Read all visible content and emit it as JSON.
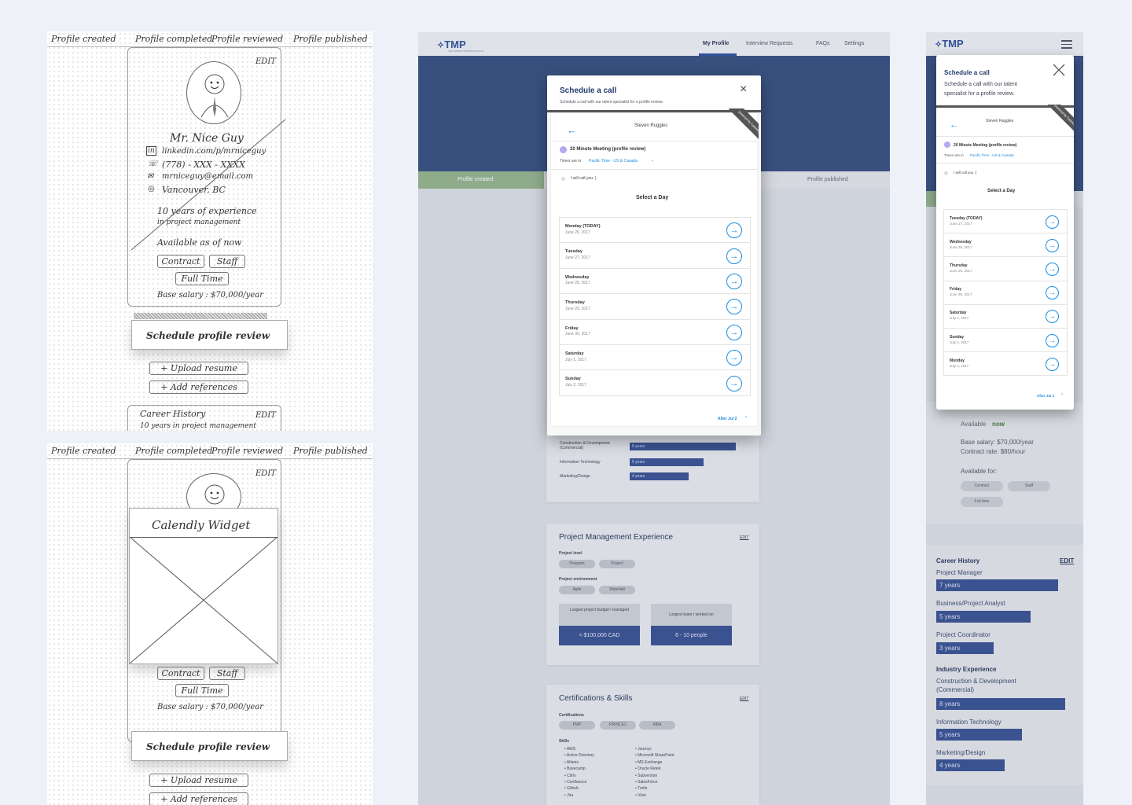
{
  "sketch": {
    "breadcrumbs": [
      "Profile created",
      "Profile completed",
      "Profile reviewed",
      "Profile published"
    ],
    "edit": "EDIT",
    "name": "Mr. Nice Guy",
    "linkedin": "linkedin.com/p/mrniceguy",
    "phone": "(778) - XXX - XXXX",
    "email": "mrniceguy@email.com",
    "location": "Vancouver, BC",
    "experience_line1": "10 years of experience",
    "experience_line2": "in project management",
    "available": "Available as of now",
    "pill_contract": "Contract",
    "pill_staff": "Staff",
    "pill_fulltime": "Full Time",
    "salary": "Base salary : $70,000/year",
    "schedule_button": "Schedule profile review",
    "upload": "+ Upload resume",
    "references": "+ Add references",
    "career_history": "Career History",
    "career_sub": "10 years in project management",
    "calendly_widget": "Calendly Widget"
  },
  "desktop": {
    "logo": "TMP",
    "logo_sub": "THE MARKET PROFESSIONALS",
    "nav": [
      "My Profile",
      "Interview Requests",
      "FAQs",
      "Settings"
    ],
    "steps": {
      "created": "Profile created",
      "published": "Profile published"
    },
    "industry_rows": [
      {
        "label": "Construction & Development (Commercial)",
        "years": "8 years",
        "value": 8
      },
      {
        "label": "Information Technology",
        "years": "5 years",
        "value": 5
      },
      {
        "label": "Marketing/Design",
        "years": "4 years",
        "value": 4
      }
    ],
    "pm": {
      "title": "Project Management Experience",
      "edit": "EDIT",
      "level_label": "Project level",
      "levels": [
        "Program",
        "Project"
      ],
      "env_label": "Project environment",
      "envs": [
        "Agile",
        "Waterfall"
      ],
      "budget_label": "Largest project budget I managed",
      "budget_value": "< $100,000 CAD",
      "team_label": "Largest team I worked on",
      "team_value": "6 - 10 people"
    },
    "certs": {
      "title": "Certifications & Skills",
      "edit": "EDIT",
      "cert_label": "Certifications",
      "certs": [
        "PMP",
        "PRINCE2",
        "MBA"
      ],
      "skills_label": "Skills",
      "skills_left": [
        "AWS",
        "Active Directory",
        "Atlanis",
        "Basecamp",
        "Citrix",
        "Confluence",
        "Github",
        "Jira"
      ],
      "skills_right": [
        "Journys",
        "Microsoft SharePoint",
        "MS Exchange",
        "Oracle Retek",
        "Subversion",
        "SalesForce",
        "Trello",
        "Visio"
      ]
    },
    "modal": {
      "title": "Schedule a call",
      "subtitle": "Schedule a call with our talent specialist for a profile review.",
      "host": "Steven Ruggles",
      "ribbon": "powered by Calendly",
      "event": "20 Minute Meeting (profile review)",
      "tz_prefix": "Times are in",
      "tz": "Pacific Time - US & Canada",
      "call_note": "I will call you :)",
      "select_day": "Select a Day",
      "days": [
        {
          "name": "Monday (TODAY)",
          "date": "June 26, 2017"
        },
        {
          "name": "Tuesday",
          "date": "June 27, 2017"
        },
        {
          "name": "Wednesday",
          "date": "June 28, 2017"
        },
        {
          "name": "Thursday",
          "date": "June 29, 2017"
        },
        {
          "name": "Friday",
          "date": "June 30, 2017"
        },
        {
          "name": "Saturday",
          "date": "July 1, 2017"
        },
        {
          "name": "Sunday",
          "date": "July 2, 2017"
        }
      ],
      "after": "After Jul 2"
    }
  },
  "mobile": {
    "logo": "TMP",
    "modal": {
      "title": "Schedule a call",
      "subtitle_1": "Schedule a call with our talent",
      "subtitle_2": "specialist for a profile review.",
      "host": "Steven Ruggles",
      "ribbon": "powered by Calendly",
      "event": "20 Minute Meeting (profile review)",
      "tz_prefix": "Times are in",
      "tz": "Pacific Time - US & Canada",
      "call_note": "I will call you :)",
      "select_day": "Select a Day",
      "days": [
        {
          "name": "Tuesday (TODAY)",
          "date": "June 27, 2017"
        },
        {
          "name": "Wednesday",
          "date": "June 28, 2017"
        },
        {
          "name": "Thursday",
          "date": "June 29, 2017"
        },
        {
          "name": "Friday",
          "date": "June 30, 2017"
        },
        {
          "name": "Saturday",
          "date": "July 1, 2017"
        },
        {
          "name": "Sunday",
          "date": "July 2, 2017"
        },
        {
          "name": "Monday",
          "date": "July 3, 2017"
        }
      ],
      "after": "After Jul 3"
    },
    "available_prefix": "Available",
    "available_value": "now",
    "salary": "Base salary: $70,000/year",
    "rate": "Contract rate: $80/hour",
    "available_for": "Available for:",
    "tags": [
      "Contract",
      "Staff",
      "Full time"
    ],
    "career": {
      "title": "Career History",
      "edit": "EDIT",
      "rows": [
        {
          "role": "Project Manager",
          "years": "7 years",
          "value": 7
        },
        {
          "role": "Business/Project Analyst",
          "years": "5 years",
          "value": 5
        },
        {
          "role": "Project Coordinator",
          "years": "3 years",
          "value": 3
        }
      ]
    },
    "industry": {
      "title": "Industry Experience",
      "rows": [
        {
          "label_1": "Construction & Development",
          "label_2": "(Commercial)",
          "years": "8 years",
          "value": 8
        },
        {
          "label_1": "Information Technology",
          "label_2": "",
          "years": "5 years",
          "value": 5
        },
        {
          "label_1": "Marketing/Design",
          "label_2": "",
          "years": "4 years",
          "value": 4
        }
      ]
    }
  }
}
